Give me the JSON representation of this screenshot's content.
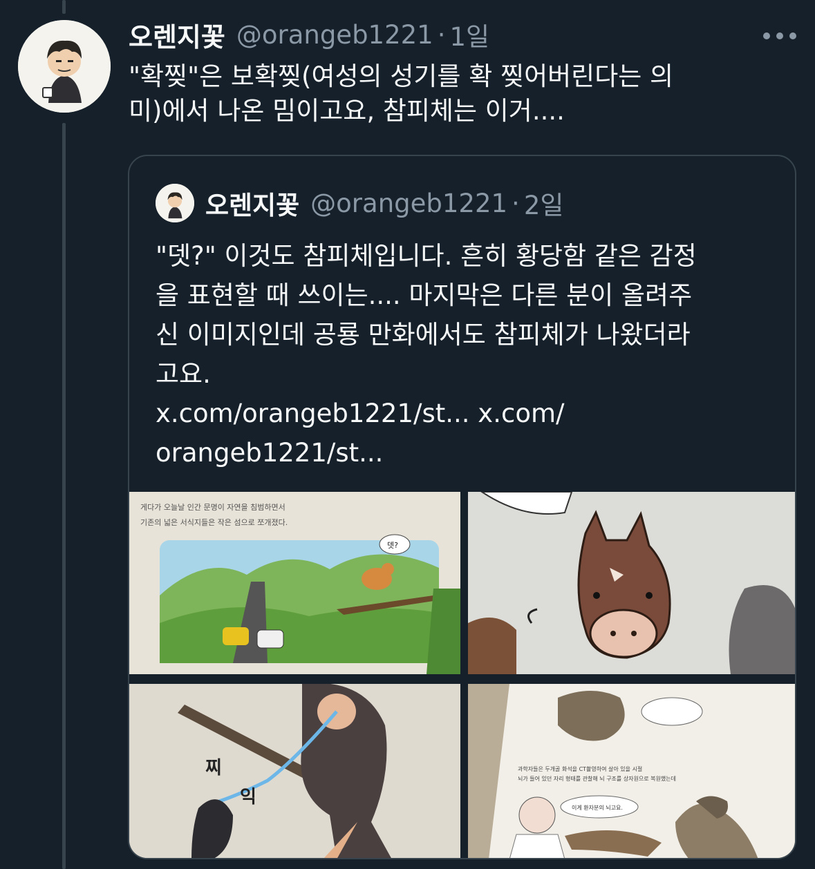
{
  "tweet": {
    "author_name": "오렌지꽃",
    "handle": "@orangeb1221",
    "separator": "·",
    "timestamp": "1일",
    "text_lines": [
      "\"확찢\"은 보확찢(여성의 성기를 확 찢어버린다는 의",
      "미)에서 나온 밈이고요, 참피체는 이거...."
    ]
  },
  "quoted_tweet": {
    "author_name": "오렌지꽃",
    "handle": "@orangeb1221",
    "separator": "·",
    "timestamp": "2일",
    "text_lines": [
      "\"뎃?\" 이것도 참피체입니다. 흔히 황당함 같은 감정",
      "을 표현할 때 쓰이는.... 마지막은 다른 분이 올려주",
      "신 이미지인데 공룡 만화에서도 참피체가 나왔더라",
      "고요.",
      "x.com/orangeb1221/st... x.com/",
      "orangeb1221/st..."
    ],
    "media": {
      "image1_text_line1": "게다가 오늘날 인간 문명이 자연을 침범하면서",
      "image1_text_line2": "기존의 넓은 서식지들은 작은 섬으로 쪼개졌다.",
      "image1_bubble": "뎃?",
      "image3_sfx_1": "찌",
      "image3_sfx_2": "익",
      "image4_caption_line1": "과학자들은 두개골 화석을 CT촬영하여 살아 있을 시절",
      "image4_caption_line2": "뇌가 들어 있던 자리 형태를 관찰해 뇌 구조를 상자원으로 복원했는데",
      "image4_bubble": "이게 환자분의 뇌고요."
    }
  },
  "colors": {
    "background": "#15202b",
    "border": "#38444d",
    "secondary_text": "#8b98a5",
    "primary_text": "#f7f9f9"
  }
}
